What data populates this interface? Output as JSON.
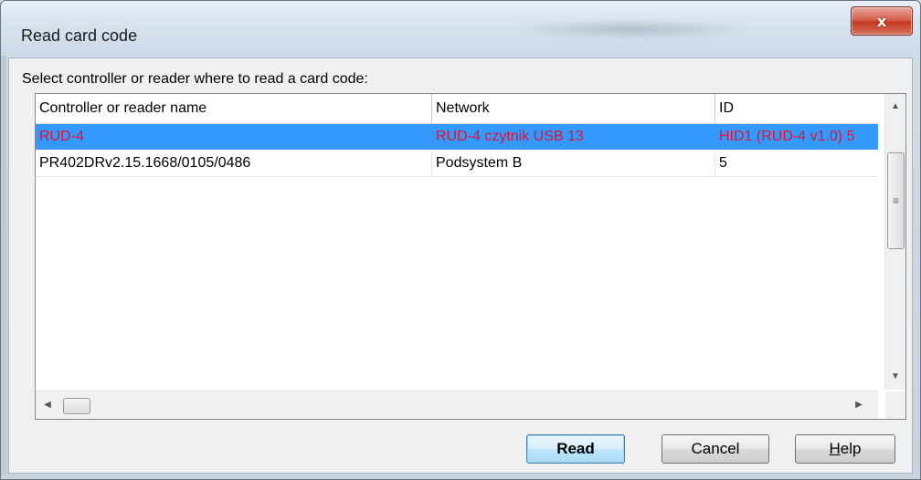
{
  "window": {
    "title": "Read card code",
    "close_label": "x"
  },
  "prompt": "Select controller or reader where to read a card code:",
  "list": {
    "columns": [
      "Controller or reader name",
      "Network",
      "ID"
    ],
    "rows": [
      {
        "name": "RUD-4",
        "network": "RUD-4 czytnik USB 13",
        "id": "HID1 (RUD-4 v1.0) 5",
        "selected": true
      },
      {
        "name": "PR402DRv2.15.1668/0105/0486",
        "network": "Podsystem B",
        "id": "5",
        "selected": false
      }
    ],
    "colors": {
      "selection_bg": "#3399ff",
      "selection_text": "#e8102a"
    }
  },
  "buttons": {
    "read": "Read",
    "cancel": "Cancel",
    "help_underlined": "H",
    "help_rest": "elp"
  },
  "icons": {
    "close": "close-icon",
    "scroll_up": "arrow-up-icon",
    "scroll_down": "arrow-down-icon",
    "scroll_left": "arrow-left-icon",
    "scroll_right": "arrow-right-icon",
    "grip": "grip-icon"
  }
}
